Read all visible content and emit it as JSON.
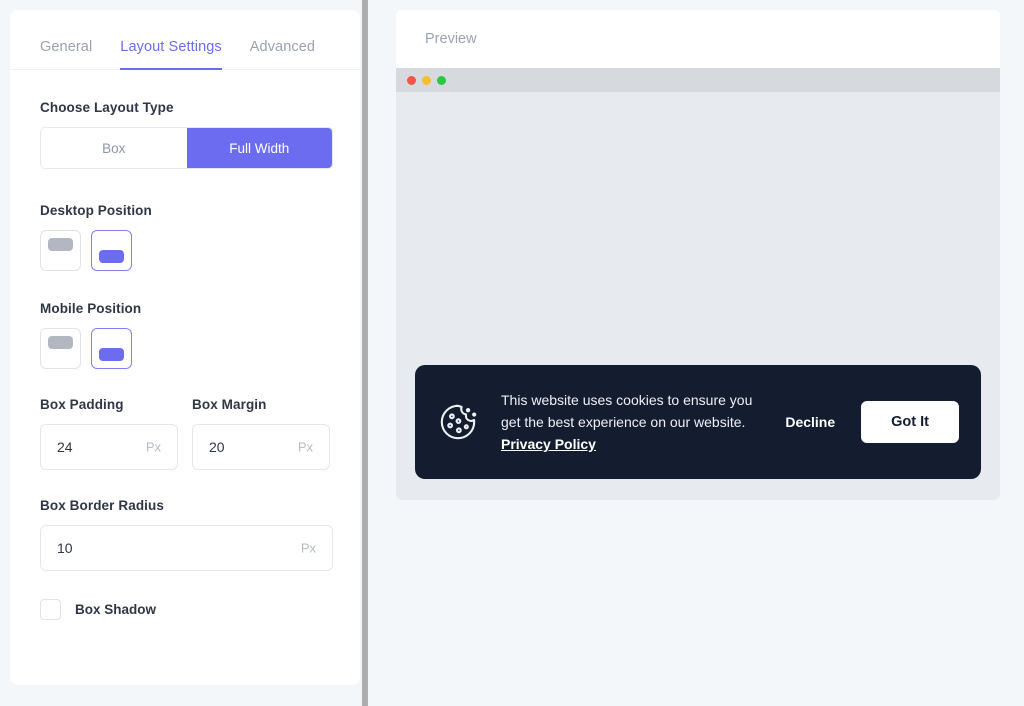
{
  "settings": {
    "tabs": [
      {
        "label": "General",
        "active": false
      },
      {
        "label": "Layout Settings",
        "active": true
      },
      {
        "label": "Advanced",
        "active": false
      }
    ],
    "layout_type": {
      "label": "Choose Layout Type",
      "options": [
        "Box",
        "Full Width"
      ],
      "selected": "Full Width"
    },
    "desktop_position": {
      "label": "Desktop Position",
      "options": [
        "top",
        "bottom"
      ],
      "selected": "bottom"
    },
    "mobile_position": {
      "label": "Mobile Position",
      "options": [
        "top",
        "bottom"
      ],
      "selected": "bottom"
    },
    "box_padding": {
      "label": "Box Padding",
      "value": "24",
      "unit": "Px"
    },
    "box_margin": {
      "label": "Box Margin",
      "value": "20",
      "unit": "Px"
    },
    "box_border_radius": {
      "label": "Box Border Radius",
      "value": "10",
      "unit": "Px"
    },
    "box_shadow": {
      "label": "Box Shadow",
      "checked": false
    }
  },
  "preview": {
    "title": "Preview",
    "window_dots": [
      "red",
      "yellow",
      "green"
    ],
    "cookie_banner": {
      "icon": "cookie-icon",
      "message_line1": "This website uses cookies to ensure you",
      "message_line2": "get the best experience on our website.",
      "privacy_link": "Privacy Policy",
      "decline_label": "Decline",
      "accept_label": "Got It"
    }
  },
  "colors": {
    "accent": "#6c6cf0",
    "banner_bg": "#141c30",
    "page_bg": "#f4f7fa",
    "viewport_bg": "#e7eaee"
  }
}
